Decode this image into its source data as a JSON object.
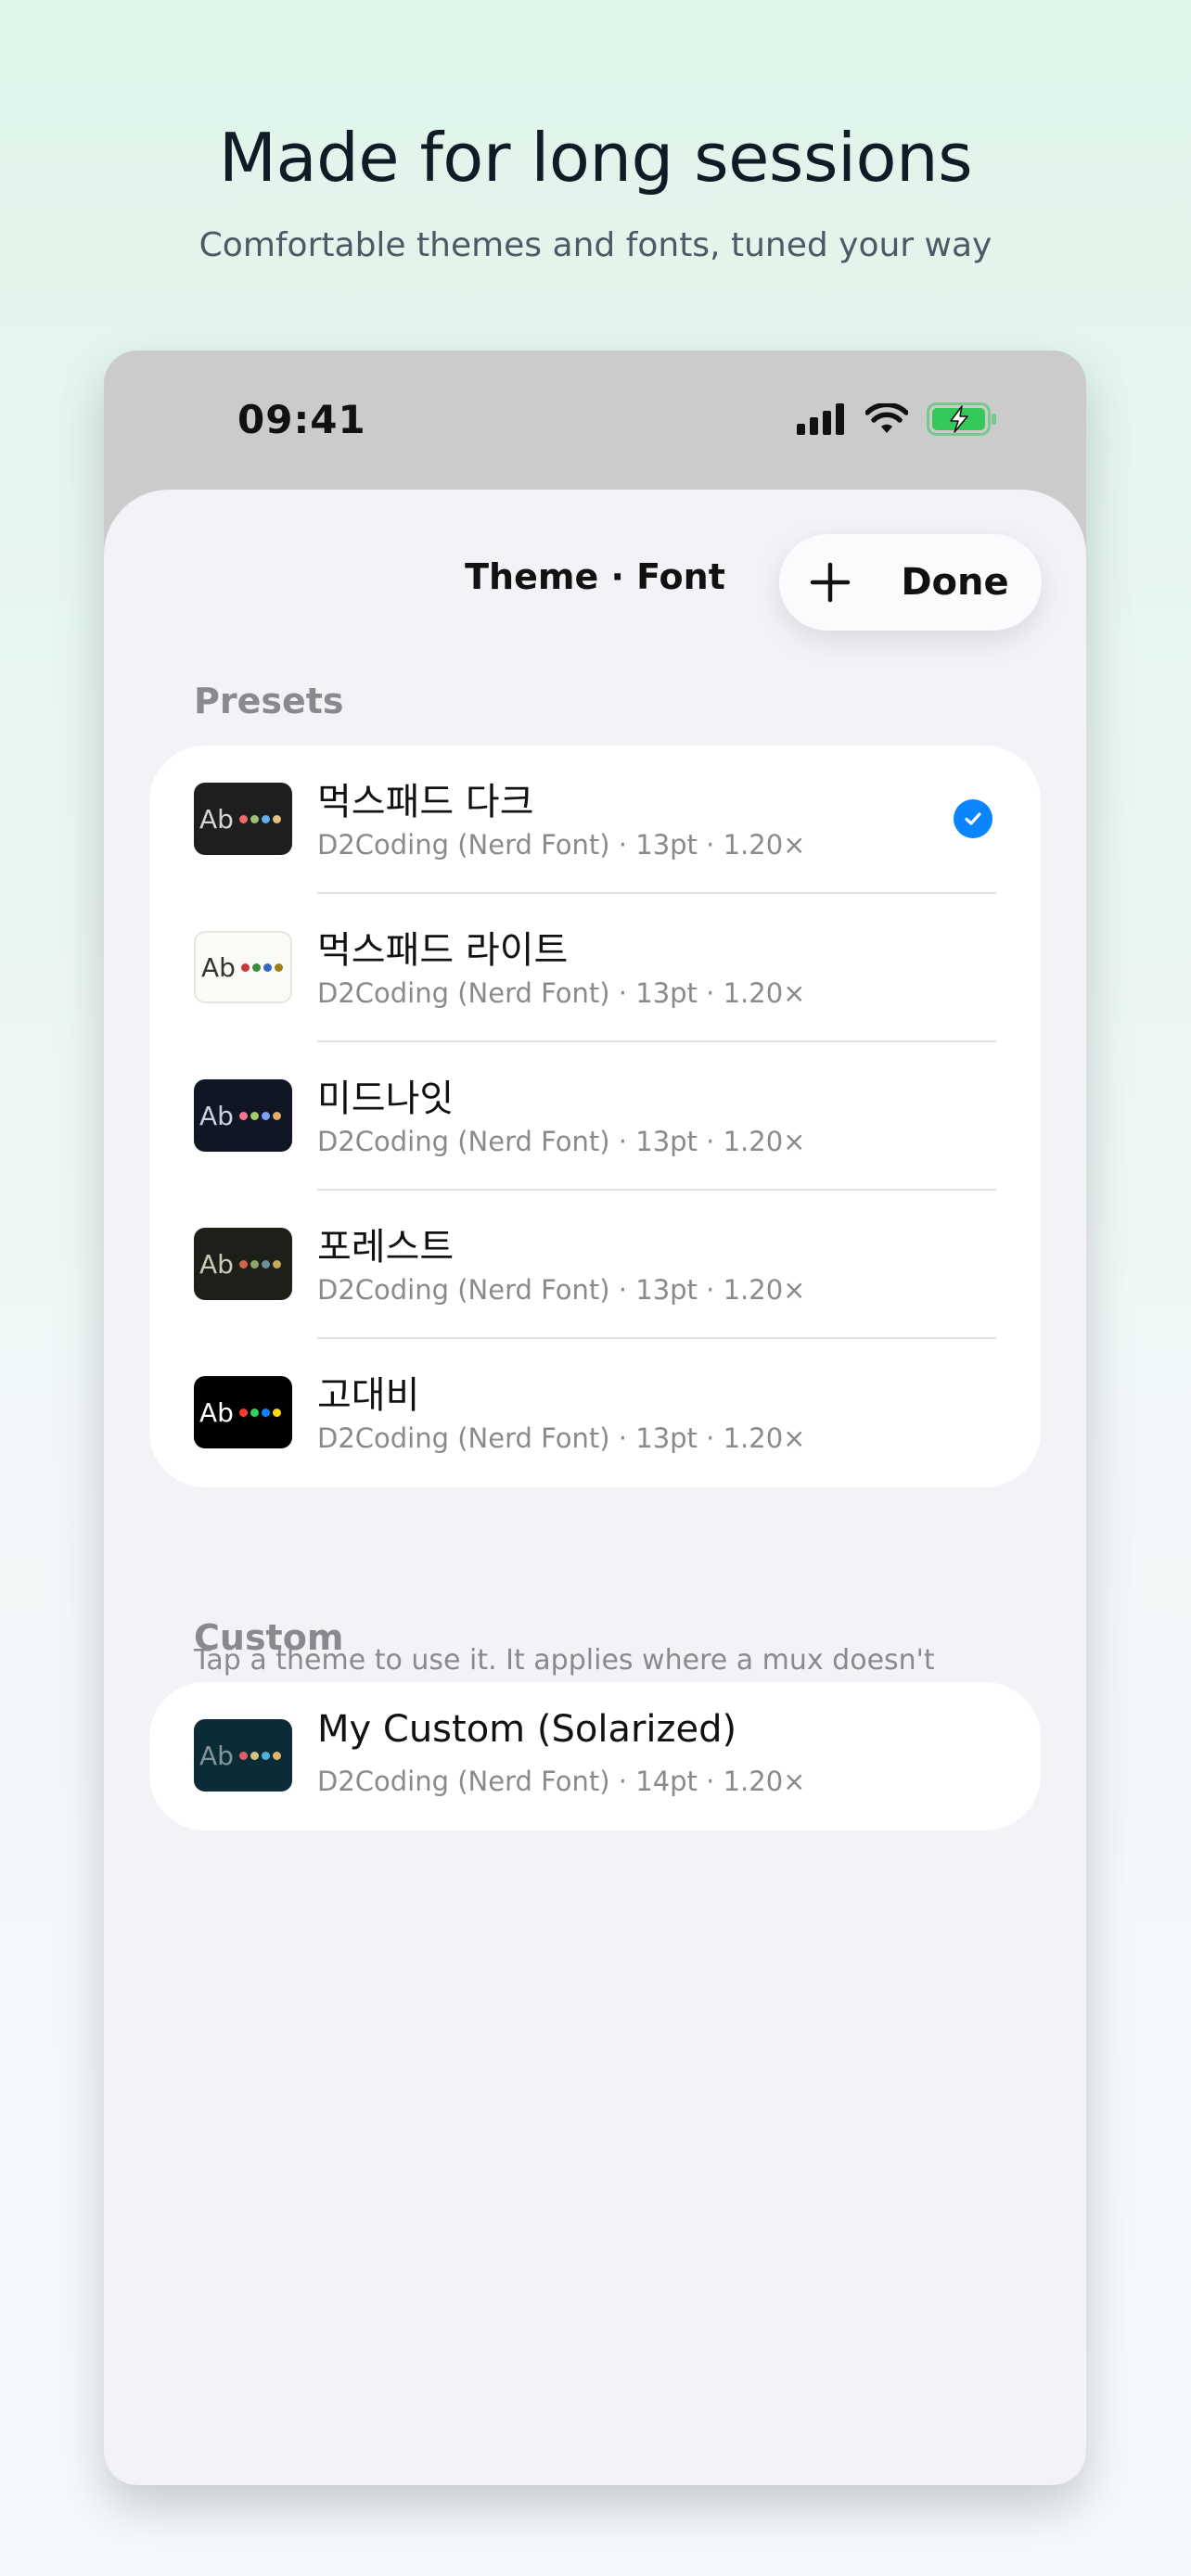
{
  "hero": {
    "title": "Made for long sessions",
    "subtitle": "Comfortable themes and fonts, tuned your way"
  },
  "status_bar": {
    "time": "09:41",
    "icons": [
      "signal-bars-icon",
      "wifi-icon",
      "battery-charging-icon"
    ],
    "battery_color": "#34c759"
  },
  "sheet": {
    "title": "Theme · Font",
    "done_label": "Done",
    "add_icon": "plus-icon"
  },
  "presets": {
    "header": "Presets",
    "items": [
      {
        "name": "먹스패드 다크",
        "detail": "D2Coding (Nerd Font) · 13pt · 1.20×",
        "swatch_label": "Ab",
        "bg": "#1e1e1e",
        "fg": "#d4d4d4",
        "dots": [
          "#f16b6b",
          "#98c379",
          "#61afef",
          "#e5c07b"
        ],
        "selected": true
      },
      {
        "name": "먹스패드 라이트",
        "detail": "D2Coding (Nerd Font) · 13pt · 1.20×",
        "swatch_label": "Ab",
        "bg": "#fafaf7",
        "fg": "#333333",
        "dots": [
          "#c43b3b",
          "#3d8b3d",
          "#3466c2",
          "#a07d16"
        ],
        "selected": false
      },
      {
        "name": "미드나잇",
        "detail": "D2Coding (Nerd Font) · 13pt · 1.20×",
        "swatch_label": "Ab",
        "bg": "#111624",
        "fg": "#c9d1e0",
        "dots": [
          "#f7768e",
          "#9ece6a",
          "#7aa2f7",
          "#e0af68"
        ],
        "selected": false
      },
      {
        "name": "포레스트",
        "detail": "D2Coding (Nerd Font) · 13pt · 1.20×",
        "swatch_label": "Ab",
        "bg": "#1c2019",
        "fg": "#c8cbb8",
        "dots": [
          "#d0644f",
          "#8fa36b",
          "#6b8f9e",
          "#c8a95e"
        ],
        "selected": false
      },
      {
        "name": "고대비",
        "detail": "D2Coding (Nerd Font) · 13pt · 1.20×",
        "swatch_label": "Ab",
        "bg": "#000000",
        "fg": "#ffffff",
        "dots": [
          "#ff3b30",
          "#30d158",
          "#0a84ff",
          "#ffd60a"
        ],
        "selected": false
      }
    ],
    "footnote": "Tap a theme to use it. It applies where a mux doesn't specify its own."
  },
  "custom": {
    "header": "Custom",
    "items": [
      {
        "name": "My Custom (Solarized)",
        "detail": "D2Coding (Nerd Font) · 14pt · 1.20×",
        "swatch_label": "Ab",
        "bg": "#0b2b36",
        "fg": "#839496",
        "dots": [
          "#dc5f6a",
          "#d6c27a",
          "#4fb0d8",
          "#e6b366"
        ],
        "selected": false
      }
    ]
  }
}
